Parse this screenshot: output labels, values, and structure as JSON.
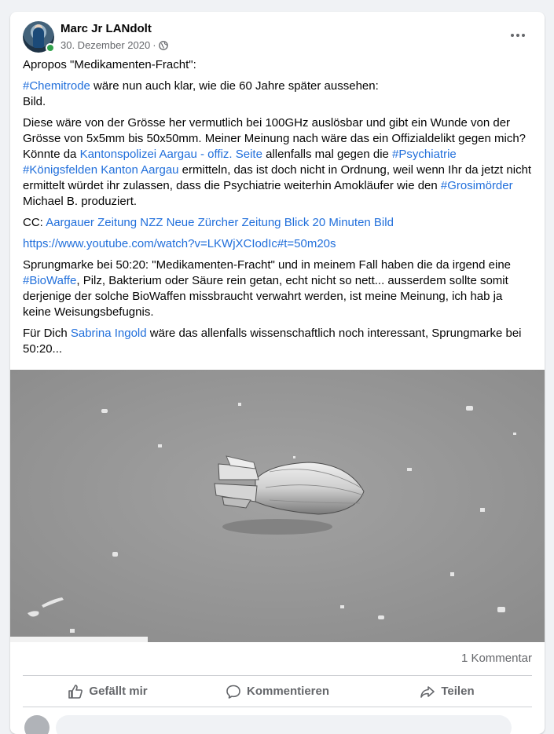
{
  "post": {
    "author": "Marc Jr LANdolt",
    "date": "30. Dezember 2020",
    "separator": "·",
    "audience_icon": "globe-icon",
    "online_color": "#31a24c"
  },
  "content": {
    "p1": "Apropos \"Medikamenten-Fracht\":",
    "p2_link": "#Chemitrode",
    "p2_text": " wäre nun auch klar, wie die 60 Jahre später aussehen:",
    "p2_line2": "Bild.",
    "p3_a": "Diese wäre von der Grösse her vermutlich bei 100GHz auslösbar und gibt ein Wunde von der Grösse von 5x5mm bis 50x50mm. Meiner Meinung nach wäre das ein Offizialdelikt gegen mich? Könnte da ",
    "p3_link1": "Kantonspolizei Aargau - offiz. Seite",
    "p3_b": " allenfalls mal gegen die ",
    "p3_link2": "#Psychiatrie",
    "p3_link3": "#Königsfelden",
    "p3_link4": "Kanton Aargau",
    "p3_c": " ermitteln, das ist doch nicht in Ordnung, weil wenn Ihr da jetzt nicht ermittelt würdet ihr zulassen, dass die Psychiatrie weiterhin Amokläufer wie den ",
    "p3_link5": "#Grosimörder",
    "p3_d": " Michael B. produziert.",
    "p4_label": "CC: ",
    "p4_links": [
      "Aargauer Zeitung",
      "NZZ",
      "Neue Zürcher Zeitung",
      "Blick",
      "20 Minuten",
      "Bild"
    ],
    "p5_url": "https://www.youtube.com/watch?v=LKWjXCIodIc#t=50m20s",
    "p6_a": "Sprungmarke bei 50:20: \"Medikamenten-Fracht\" und in meinem Fall haben die da irgend eine ",
    "p6_link": "#BioWaffe",
    "p6_b": ", Pilz, Bakterium oder Säure rein getan, echt nicht so nett... ausserdem sollte somit derjenige der solche BioWaffen missbraucht verwahrt werden, ist meine Meinung, ich hab ja keine Weisungsbefugnis.",
    "p7_a": "Für Dich ",
    "p7_link": "Sabrina Ingold",
    "p7_b": " wäre das allenfalls wissenschaftlich noch interessant, Sprungmarke bei 50:20..."
  },
  "footer": {
    "comments_count": "1 Kommentar",
    "like_label": "Gefällt mir",
    "comment_label": "Kommentieren",
    "share_label": "Teilen"
  },
  "colors": {
    "link": "#216fdb",
    "secondary_text": "#65676b",
    "background": "#f0f2f5"
  }
}
